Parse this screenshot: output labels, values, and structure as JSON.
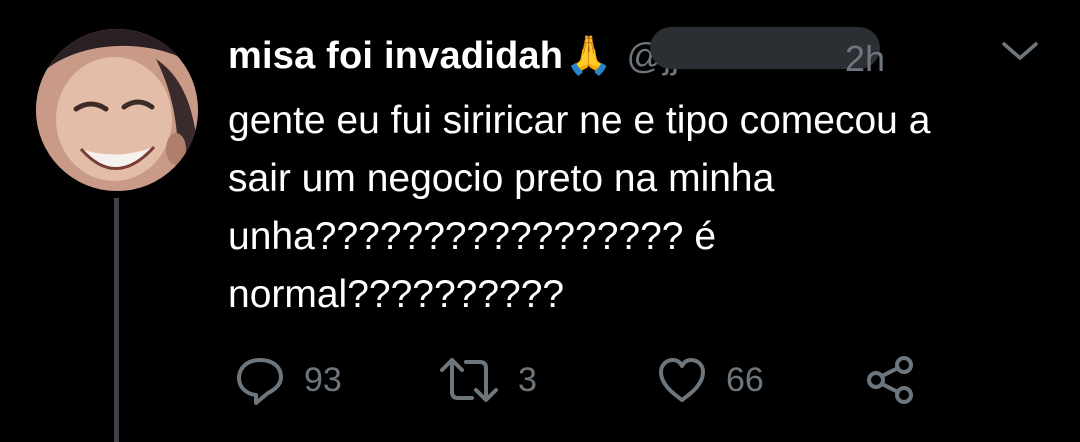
{
  "tweet": {
    "display_name": "misa foi invadidah",
    "emoji": "🙏",
    "handle": "@jjnoot",
    "time": "2h",
    "text": "gente eu fui siriricar ne e tipo comecou a\nsair um negocio preto na minha\nunha????????????????? é\nnormal??????????",
    "avatar_icon": "avatar"
  },
  "actions": {
    "reply": {
      "icon": "reply-icon",
      "count": "93"
    },
    "retweet": {
      "icon": "retweet-icon",
      "count": "3"
    },
    "like": {
      "icon": "like-icon",
      "count": "66"
    },
    "share": {
      "icon": "share-icon"
    }
  },
  "colors": {
    "background": "#000000",
    "text": "#ffffff",
    "muted": "#6e767d",
    "thread_line": "#3d4349"
  }
}
